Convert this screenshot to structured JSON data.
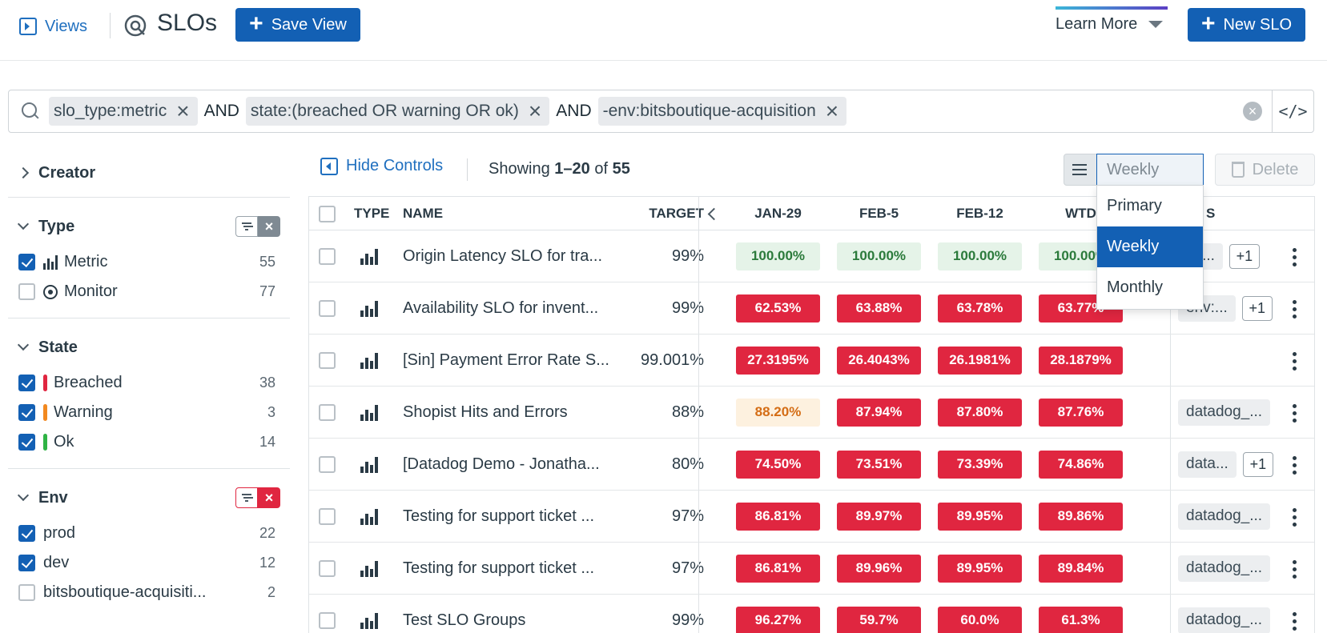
{
  "header": {
    "views_label": "Views",
    "title": "SLOs",
    "save_view_label": "Save View",
    "learn_more_label": "Learn More",
    "new_slo_label": "New SLO"
  },
  "search": {
    "chips": [
      "slo_type:metric",
      "state:(breached OR warning OR ok)",
      "-env:bitsboutique-acquisition"
    ],
    "operators": [
      "AND",
      "AND"
    ],
    "code_label": "</>"
  },
  "facets": {
    "creator": {
      "title": "Creator"
    },
    "type": {
      "title": "Type",
      "items": [
        {
          "label": "Metric",
          "count": "55",
          "checked": true
        },
        {
          "label": "Monitor",
          "count": "77",
          "checked": false
        }
      ]
    },
    "state": {
      "title": "State",
      "items": [
        {
          "label": "Breached",
          "count": "38",
          "color": "#e02640"
        },
        {
          "label": "Warning",
          "count": "3",
          "color": "#f2891f"
        },
        {
          "label": "Ok",
          "count": "14",
          "color": "#2fb344"
        }
      ]
    },
    "env": {
      "title": "Env",
      "items": [
        {
          "label": "prod",
          "count": "22",
          "checked": true
        },
        {
          "label": "dev",
          "count": "12",
          "checked": true
        },
        {
          "label": "bitsboutique-acquisiti...",
          "count": "2",
          "checked": false
        }
      ]
    }
  },
  "toolbar": {
    "hide_controls_label": "Hide Controls",
    "showing_prefix": "Showing ",
    "showing_range": "1–20",
    "showing_of": " of ",
    "showing_total": "55",
    "select_value": "Weekly",
    "delete_label": "Delete"
  },
  "dropdown": {
    "options": [
      "Primary",
      "Weekly",
      "Monthly"
    ],
    "selected": "Weekly"
  },
  "table": {
    "headers": {
      "type": "TYPE",
      "name": "NAME",
      "target": "TARGET",
      "c1": "JAN-29",
      "c2": "FEB-5",
      "c3": "FEB-12",
      "c4": "WTD",
      "tags": "S"
    },
    "rows": [
      {
        "name": "Origin Latency SLO for tra...",
        "target": "99%",
        "vals": [
          "100.00%",
          "100.00%",
          "100.00%",
          "100.00%"
        ],
        "status": [
          "ok",
          "ok",
          "ok",
          "ok"
        ],
        "tag": "sh...",
        "plus": "+1"
      },
      {
        "name": "Availability SLO for invent...",
        "target": "99%",
        "vals": [
          "62.53%",
          "63.88%",
          "63.78%",
          "63.77%"
        ],
        "status": [
          "bad",
          "bad",
          "bad",
          "bad"
        ],
        "tag": "env:...",
        "plus": "+1"
      },
      {
        "name": "[Sin] Payment Error Rate S...",
        "target": "99.001%",
        "vals": [
          "27.3195%",
          "26.4043%",
          "26.1981%",
          "28.1879%"
        ],
        "status": [
          "bad",
          "bad",
          "bad",
          "bad"
        ],
        "tag": "",
        "plus": ""
      },
      {
        "name": "Shopist Hits and Errors",
        "target": "88%",
        "vals": [
          "88.20%",
          "87.94%",
          "87.80%",
          "87.76%"
        ],
        "status": [
          "warn",
          "bad",
          "bad",
          "bad"
        ],
        "tag": "datadog_...",
        "plus": ""
      },
      {
        "name": "[Datadog Demo - Jonatha...",
        "target": "80%",
        "vals": [
          "74.50%",
          "73.51%",
          "73.39%",
          "74.86%"
        ],
        "status": [
          "bad",
          "bad",
          "bad",
          "bad"
        ],
        "tag": "data...",
        "plus": "+1"
      },
      {
        "name": "Testing for support ticket ...",
        "target": "97%",
        "vals": [
          "86.81%",
          "89.97%",
          "89.95%",
          "89.86%"
        ],
        "status": [
          "bad",
          "bad",
          "bad",
          "bad"
        ],
        "tag": "datadog_...",
        "plus": ""
      },
      {
        "name": "Testing for support ticket ...",
        "target": "97%",
        "vals": [
          "86.81%",
          "89.96%",
          "89.95%",
          "89.84%"
        ],
        "status": [
          "bad",
          "bad",
          "bad",
          "bad"
        ],
        "tag": "datadog_...",
        "plus": ""
      },
      {
        "name": "Test SLO Groups",
        "target": "99%",
        "vals": [
          "96.27%",
          "59.7%",
          "60.0%",
          "61.3%"
        ],
        "status": [
          "bad",
          "bad",
          "bad",
          "bad"
        ],
        "tag": "datadog_...",
        "plus": ""
      }
    ]
  }
}
